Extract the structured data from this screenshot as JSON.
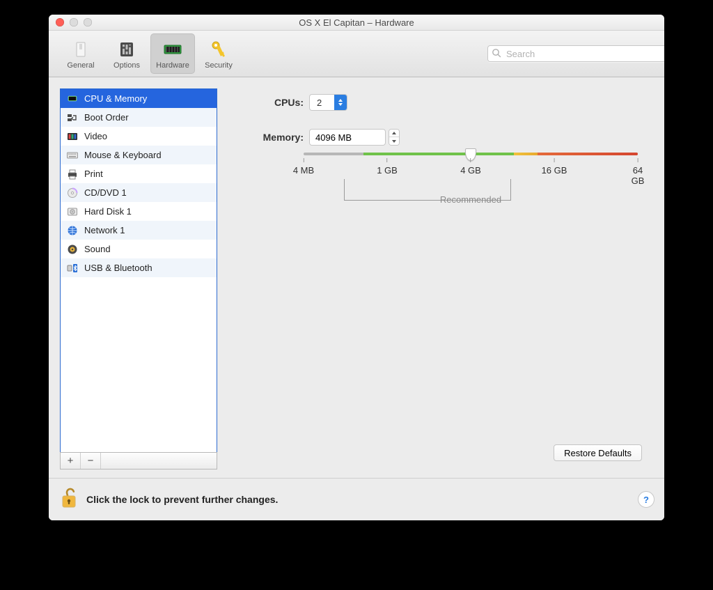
{
  "window": {
    "title": "OS X El Capitan – Hardware"
  },
  "toolbar": {
    "tabs": [
      {
        "label": "General"
      },
      {
        "label": "Options"
      },
      {
        "label": "Hardware"
      },
      {
        "label": "Security"
      }
    ],
    "active_index": 2,
    "search_placeholder": "Search"
  },
  "sidebar": {
    "items": [
      {
        "label": "CPU & Memory"
      },
      {
        "label": "Boot Order"
      },
      {
        "label": "Video"
      },
      {
        "label": "Mouse & Keyboard"
      },
      {
        "label": "Print"
      },
      {
        "label": "CD/DVD 1"
      },
      {
        "label": "Hard Disk 1"
      },
      {
        "label": "Network 1"
      },
      {
        "label": "Sound"
      },
      {
        "label": "USB & Bluetooth"
      }
    ],
    "selected_index": 0,
    "add_symbol": "+",
    "remove_symbol": "−"
  },
  "panel": {
    "cpus_label": "CPUs:",
    "cpus_value": "2",
    "memory_label": "Memory:",
    "memory_value": "4096 MB",
    "slider": {
      "ticks": [
        "4 MB",
        "1 GB",
        "4 GB",
        "16 GB",
        "64 GB"
      ],
      "recommended_label": "Recommended",
      "green_start_pct": 18,
      "green_end_pct": 63,
      "yellow_end_pct": 70,
      "red_end_pct": 100,
      "thumb_pct": 50,
      "rec_start_pct": 12,
      "rec_end_pct": 62
    },
    "restore_label": "Restore Defaults"
  },
  "footer": {
    "lock_message": "Click the lock to prevent further changes.",
    "help_symbol": "?"
  }
}
